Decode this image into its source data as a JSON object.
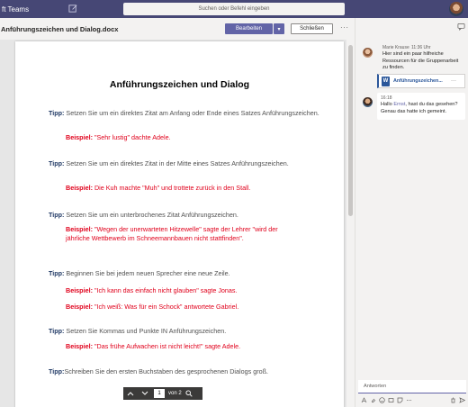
{
  "app": {
    "title": "ft Teams",
    "search_placeholder": "Suchen oder Befehl eingeben",
    "colors": {
      "titlebar": "#464775",
      "accent": "#6264a7",
      "tip": "#1f3864",
      "example": "#e0001b",
      "word": "#2b579a"
    }
  },
  "doc_header": {
    "title": "Anführungszeichen und Dialog.docx",
    "edit_label": "Bearbeiten",
    "close_label": "Schließen",
    "more_label": "···"
  },
  "document": {
    "heading": "Anführungszeichen und Dialog",
    "sections": [
      {
        "tip_label": "Tipp:",
        "tip_text": " Setzen Sie um ein direktes Zitat am Anfang oder Ende eines Satzes Anführungszeichen.",
        "examples": [
          {
            "label": "Beispiel:",
            "text": " \"Sehr lustig\" dachte Adele."
          }
        ]
      },
      {
        "tip_label": "Tipp:",
        "tip_text": " Setzen Sie um ein direktes Zitat in der Mitte eines Satzes Anführungszeichen.",
        "examples": [
          {
            "label": "Beispiel:",
            "text": " Die Kuh machte \"Muh\" und trottete zurück in den Stall."
          }
        ]
      },
      {
        "tip_label": "Tipp:",
        "tip_text": " Setzen Sie um ein unterbrochenes Zitat Anführungszeichen.",
        "examples": [
          {
            "label": "Beispiel:",
            "text": " \"Wegen der unerwarteten Hitzewelle\" sagte der Lehrer \"wird der jährliche Wettbewerb im Schneemannbauen nicht stattfinden\"."
          }
        ]
      },
      {
        "tip_label": "Tipp:",
        "tip_text": " Beginnen Sie bei jedem neuen Sprecher eine neue Zeile.",
        "examples": [
          {
            "label": "Beispiel:",
            "text": " \"Ich kann das einfach nicht glauben\" sagte Jonas."
          },
          {
            "label": "Beispiel:",
            "text": " \"Ich weiß: Was für ein Schock\" antwortete Gabriel."
          }
        ]
      },
      {
        "tip_label": "Tipp:",
        "tip_text": " Setzen Sie Kommas und Punkte IN Anführungszeichen.",
        "examples": [
          {
            "label": "Beispiel:",
            "text": " \"Das frühe Aufwachen ist nicht leicht!\" sagte Adele."
          }
        ]
      },
      {
        "tip_label": "Tipp:",
        "tip_text": "Schreiben Sie den ersten Buchstaben des gesprochenen Dialogs groß.",
        "examples": []
      }
    ]
  },
  "pager": {
    "current_page": "1",
    "total_label": "von 2"
  },
  "chat": {
    "messages": [
      {
        "author": "Marie Krause",
        "time": "11:36 Uhr",
        "text": "Hier sind ein paar hilfreiche Ressourcen für die Gruppenarbeit zu finden."
      },
      {
        "time": "16:18",
        "text_before": "Hallo ",
        "mention": "Ernst",
        "text_after": ", hast du das gesehen? Genau das hatte ich gemeint."
      }
    ],
    "attachment": {
      "name": "Anführungszeichen...",
      "icon": "W",
      "more": "···"
    },
    "reply_placeholder": "Antworten"
  }
}
